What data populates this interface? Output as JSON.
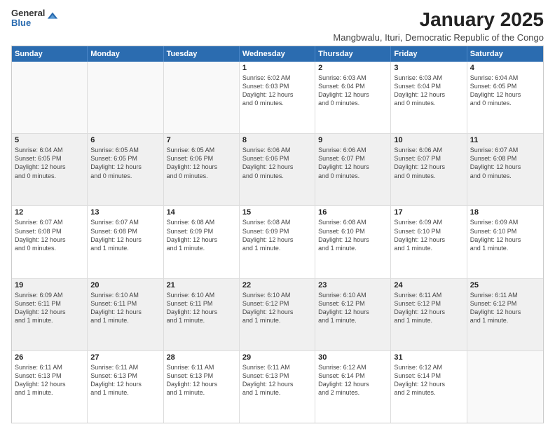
{
  "logo": {
    "general": "General",
    "blue": "Blue"
  },
  "title": "January 2025",
  "subtitle": "Mangbwalu, Ituri, Democratic Republic of the Congo",
  "header_days": [
    "Sunday",
    "Monday",
    "Tuesday",
    "Wednesday",
    "Thursday",
    "Friday",
    "Saturday"
  ],
  "weeks": [
    [
      {
        "day": "",
        "text": ""
      },
      {
        "day": "",
        "text": ""
      },
      {
        "day": "",
        "text": ""
      },
      {
        "day": "1",
        "text": "Sunrise: 6:02 AM\nSunset: 6:03 PM\nDaylight: 12 hours\nand 0 minutes."
      },
      {
        "day": "2",
        "text": "Sunrise: 6:03 AM\nSunset: 6:04 PM\nDaylight: 12 hours\nand 0 minutes."
      },
      {
        "day": "3",
        "text": "Sunrise: 6:03 AM\nSunset: 6:04 PM\nDaylight: 12 hours\nand 0 minutes."
      },
      {
        "day": "4",
        "text": "Sunrise: 6:04 AM\nSunset: 6:05 PM\nDaylight: 12 hours\nand 0 minutes."
      }
    ],
    [
      {
        "day": "5",
        "text": "Sunrise: 6:04 AM\nSunset: 6:05 PM\nDaylight: 12 hours\nand 0 minutes."
      },
      {
        "day": "6",
        "text": "Sunrise: 6:05 AM\nSunset: 6:05 PM\nDaylight: 12 hours\nand 0 minutes."
      },
      {
        "day": "7",
        "text": "Sunrise: 6:05 AM\nSunset: 6:06 PM\nDaylight: 12 hours\nand 0 minutes."
      },
      {
        "day": "8",
        "text": "Sunrise: 6:06 AM\nSunset: 6:06 PM\nDaylight: 12 hours\nand 0 minutes."
      },
      {
        "day": "9",
        "text": "Sunrise: 6:06 AM\nSunset: 6:07 PM\nDaylight: 12 hours\nand 0 minutes."
      },
      {
        "day": "10",
        "text": "Sunrise: 6:06 AM\nSunset: 6:07 PM\nDaylight: 12 hours\nand 0 minutes."
      },
      {
        "day": "11",
        "text": "Sunrise: 6:07 AM\nSunset: 6:08 PM\nDaylight: 12 hours\nand 0 minutes."
      }
    ],
    [
      {
        "day": "12",
        "text": "Sunrise: 6:07 AM\nSunset: 6:08 PM\nDaylight: 12 hours\nand 0 minutes."
      },
      {
        "day": "13",
        "text": "Sunrise: 6:07 AM\nSunset: 6:08 PM\nDaylight: 12 hours\nand 1 minute."
      },
      {
        "day": "14",
        "text": "Sunrise: 6:08 AM\nSunset: 6:09 PM\nDaylight: 12 hours\nand 1 minute."
      },
      {
        "day": "15",
        "text": "Sunrise: 6:08 AM\nSunset: 6:09 PM\nDaylight: 12 hours\nand 1 minute."
      },
      {
        "day": "16",
        "text": "Sunrise: 6:08 AM\nSunset: 6:10 PM\nDaylight: 12 hours\nand 1 minute."
      },
      {
        "day": "17",
        "text": "Sunrise: 6:09 AM\nSunset: 6:10 PM\nDaylight: 12 hours\nand 1 minute."
      },
      {
        "day": "18",
        "text": "Sunrise: 6:09 AM\nSunset: 6:10 PM\nDaylight: 12 hours\nand 1 minute."
      }
    ],
    [
      {
        "day": "19",
        "text": "Sunrise: 6:09 AM\nSunset: 6:11 PM\nDaylight: 12 hours\nand 1 minute."
      },
      {
        "day": "20",
        "text": "Sunrise: 6:10 AM\nSunset: 6:11 PM\nDaylight: 12 hours\nand 1 minute."
      },
      {
        "day": "21",
        "text": "Sunrise: 6:10 AM\nSunset: 6:11 PM\nDaylight: 12 hours\nand 1 minute."
      },
      {
        "day": "22",
        "text": "Sunrise: 6:10 AM\nSunset: 6:12 PM\nDaylight: 12 hours\nand 1 minute."
      },
      {
        "day": "23",
        "text": "Sunrise: 6:10 AM\nSunset: 6:12 PM\nDaylight: 12 hours\nand 1 minute."
      },
      {
        "day": "24",
        "text": "Sunrise: 6:11 AM\nSunset: 6:12 PM\nDaylight: 12 hours\nand 1 minute."
      },
      {
        "day": "25",
        "text": "Sunrise: 6:11 AM\nSunset: 6:12 PM\nDaylight: 12 hours\nand 1 minute."
      }
    ],
    [
      {
        "day": "26",
        "text": "Sunrise: 6:11 AM\nSunset: 6:13 PM\nDaylight: 12 hours\nand 1 minute."
      },
      {
        "day": "27",
        "text": "Sunrise: 6:11 AM\nSunset: 6:13 PM\nDaylight: 12 hours\nand 1 minute."
      },
      {
        "day": "28",
        "text": "Sunrise: 6:11 AM\nSunset: 6:13 PM\nDaylight: 12 hours\nand 1 minute."
      },
      {
        "day": "29",
        "text": "Sunrise: 6:11 AM\nSunset: 6:13 PM\nDaylight: 12 hours\nand 1 minute."
      },
      {
        "day": "30",
        "text": "Sunrise: 6:12 AM\nSunset: 6:14 PM\nDaylight: 12 hours\nand 2 minutes."
      },
      {
        "day": "31",
        "text": "Sunrise: 6:12 AM\nSunset: 6:14 PM\nDaylight: 12 hours\nand 2 minutes."
      },
      {
        "day": "",
        "text": ""
      }
    ]
  ]
}
